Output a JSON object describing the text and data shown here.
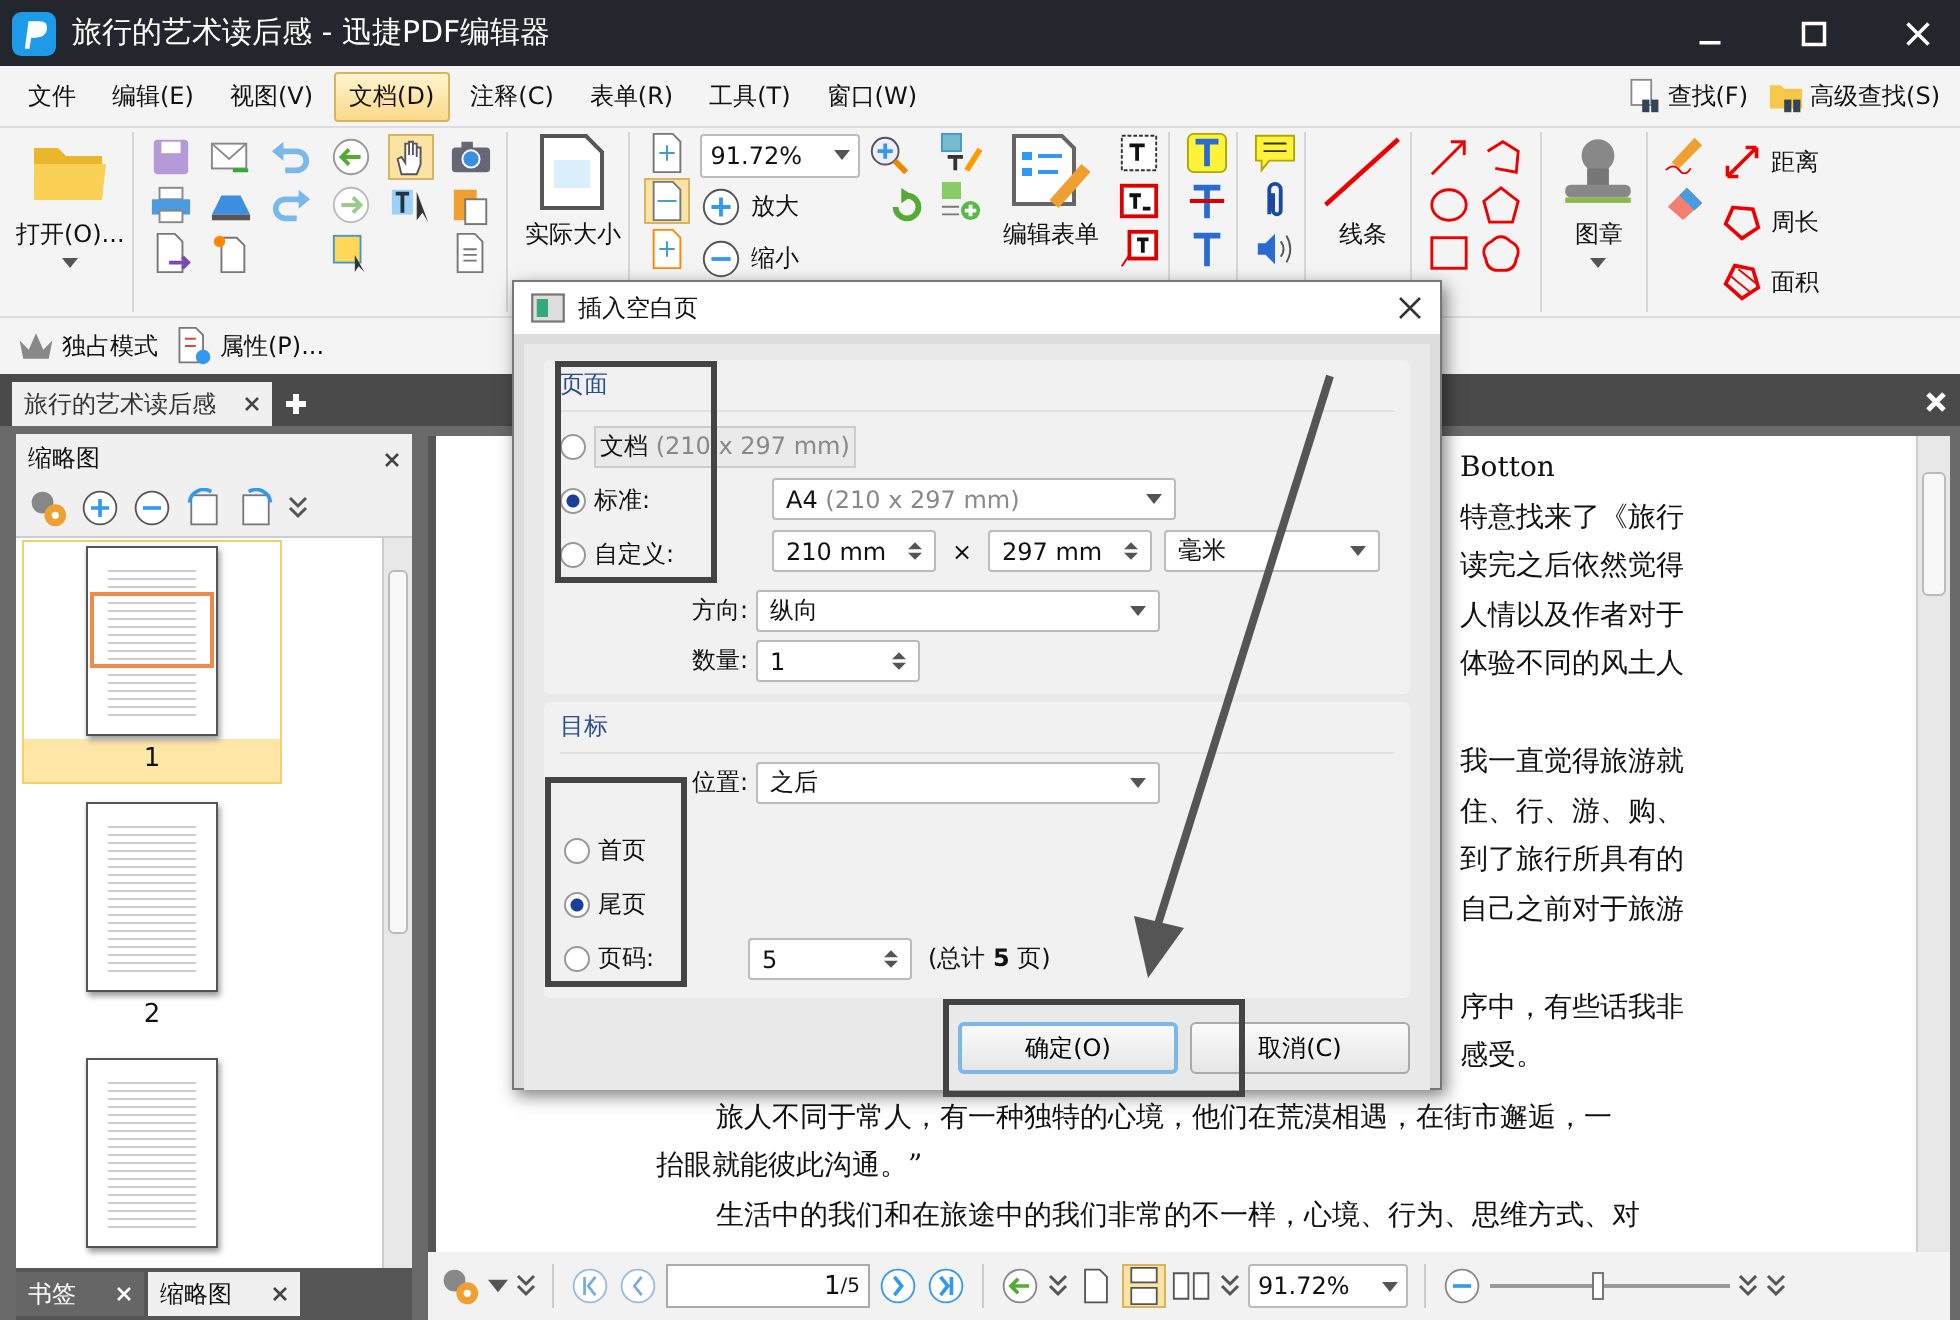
{
  "window": {
    "title": "旅行的艺术读后感 - 迅捷PDF编辑器"
  },
  "menu": [
    {
      "label": "文件",
      "selected": false
    },
    {
      "label": "编辑(E)",
      "selected": false
    },
    {
      "label": "视图(V)",
      "selected": false
    },
    {
      "label": "文档(D)",
      "selected": true
    },
    {
      "label": "注释(C)",
      "selected": false
    },
    {
      "label": "表单(R)",
      "selected": false
    },
    {
      "label": "工具(T)",
      "selected": false
    },
    {
      "label": "窗口(W)",
      "selected": false
    }
  ],
  "find_buttons": [
    {
      "label": "查找(F)",
      "kind": "find"
    },
    {
      "label": "高级查找(S)",
      "kind": "advanced"
    }
  ],
  "ribbon": {
    "open": "打开(O)...",
    "actual_size": "实际大小",
    "zoom": "91.72%",
    "zoom_in": "放大",
    "zoom_out": "缩小",
    "edit_form": "编辑表单",
    "line": "线条",
    "stamp": "图章",
    "measure": [
      {
        "label": "距离",
        "kind": "distance"
      },
      {
        "label": "周长",
        "kind": "perimeter"
      },
      {
        "label": "面积",
        "kind": "area"
      }
    ]
  },
  "subbar": [
    {
      "label": "独占模式",
      "kind": "exclusive"
    },
    {
      "label": "属性(P)...",
      "kind": "properties"
    }
  ],
  "doc_tabs": [
    {
      "label": "旅行的艺术读后感",
      "selected": true
    }
  ],
  "thumbnail_panel": {
    "title": "缩略图",
    "pages": [
      {
        "label": "1",
        "selected": true
      },
      {
        "label": "2",
        "selected": false
      },
      {
        "selected": false
      }
    ]
  },
  "panel_tabs": [
    {
      "label": "书签",
      "selected": false
    },
    {
      "label": "缩略图",
      "selected": true
    }
  ],
  "document": {
    "partial_paragraphs": [
      [
        "Botton",
        "特意找来了《旅行",
        "读完之后依然觉得",
        "人情以及作者对于",
        "体验不同的风土人"
      ],
      [
        "我一直觉得旅游就",
        "住、行、游、购、",
        "到了旅行所具有的",
        "自己之前对于旅游"
      ],
      [
        "序中，有些话我非",
        "感受。"
      ]
    ],
    "lines": [
      {
        "text": "旅人不同于常人，有一种独特的心境，他们在荒漠相遇，在街市邂逅，一",
        "indent": true
      },
      {
        "text": "抬眼就能彼此沟通。”",
        "indent": false
      },
      {
        "text": "生活中的我们和在旅途中的我们非常的不一样，心境、行为、思维方式、对",
        "indent": true
      }
    ]
  },
  "dialog": {
    "title": "插入空白页",
    "page_group": {
      "title": "页面",
      "size_options": [
        {
          "label": "文档",
          "detail": "(210 x 297 mm)",
          "selected": false
        },
        {
          "label": "标准:",
          "selected": true
        },
        {
          "label": "自定义:",
          "selected": false
        }
      ],
      "standard_size": {
        "value": "A4",
        "detail": "(210 x 297 mm)"
      },
      "width": "210 mm",
      "times": "×",
      "height": "297 mm",
      "unit": "毫米",
      "orientation": {
        "label": "方向:",
        "value": "纵向"
      },
      "count": {
        "label": "数量:",
        "value": "1"
      }
    },
    "target_group": {
      "title": "目标",
      "position": {
        "label": "位置:",
        "value": "之后"
      },
      "options": [
        {
          "label": "首页",
          "selected": false
        },
        {
          "label": "尾页",
          "selected": true
        },
        {
          "label": "页码:",
          "selected": false
        }
      ],
      "page_number": "5",
      "total_note": "(总计 **5** 页)"
    },
    "buttons": [
      {
        "label": "确定(O)",
        "default": true
      },
      {
        "label": "取消(C)",
        "default": false
      }
    ]
  },
  "status_bar": {
    "page": "1",
    "page_total": "/5",
    "zoom": "91.72%",
    "zoom_slider": {
      "level": 0.45
    }
  }
}
